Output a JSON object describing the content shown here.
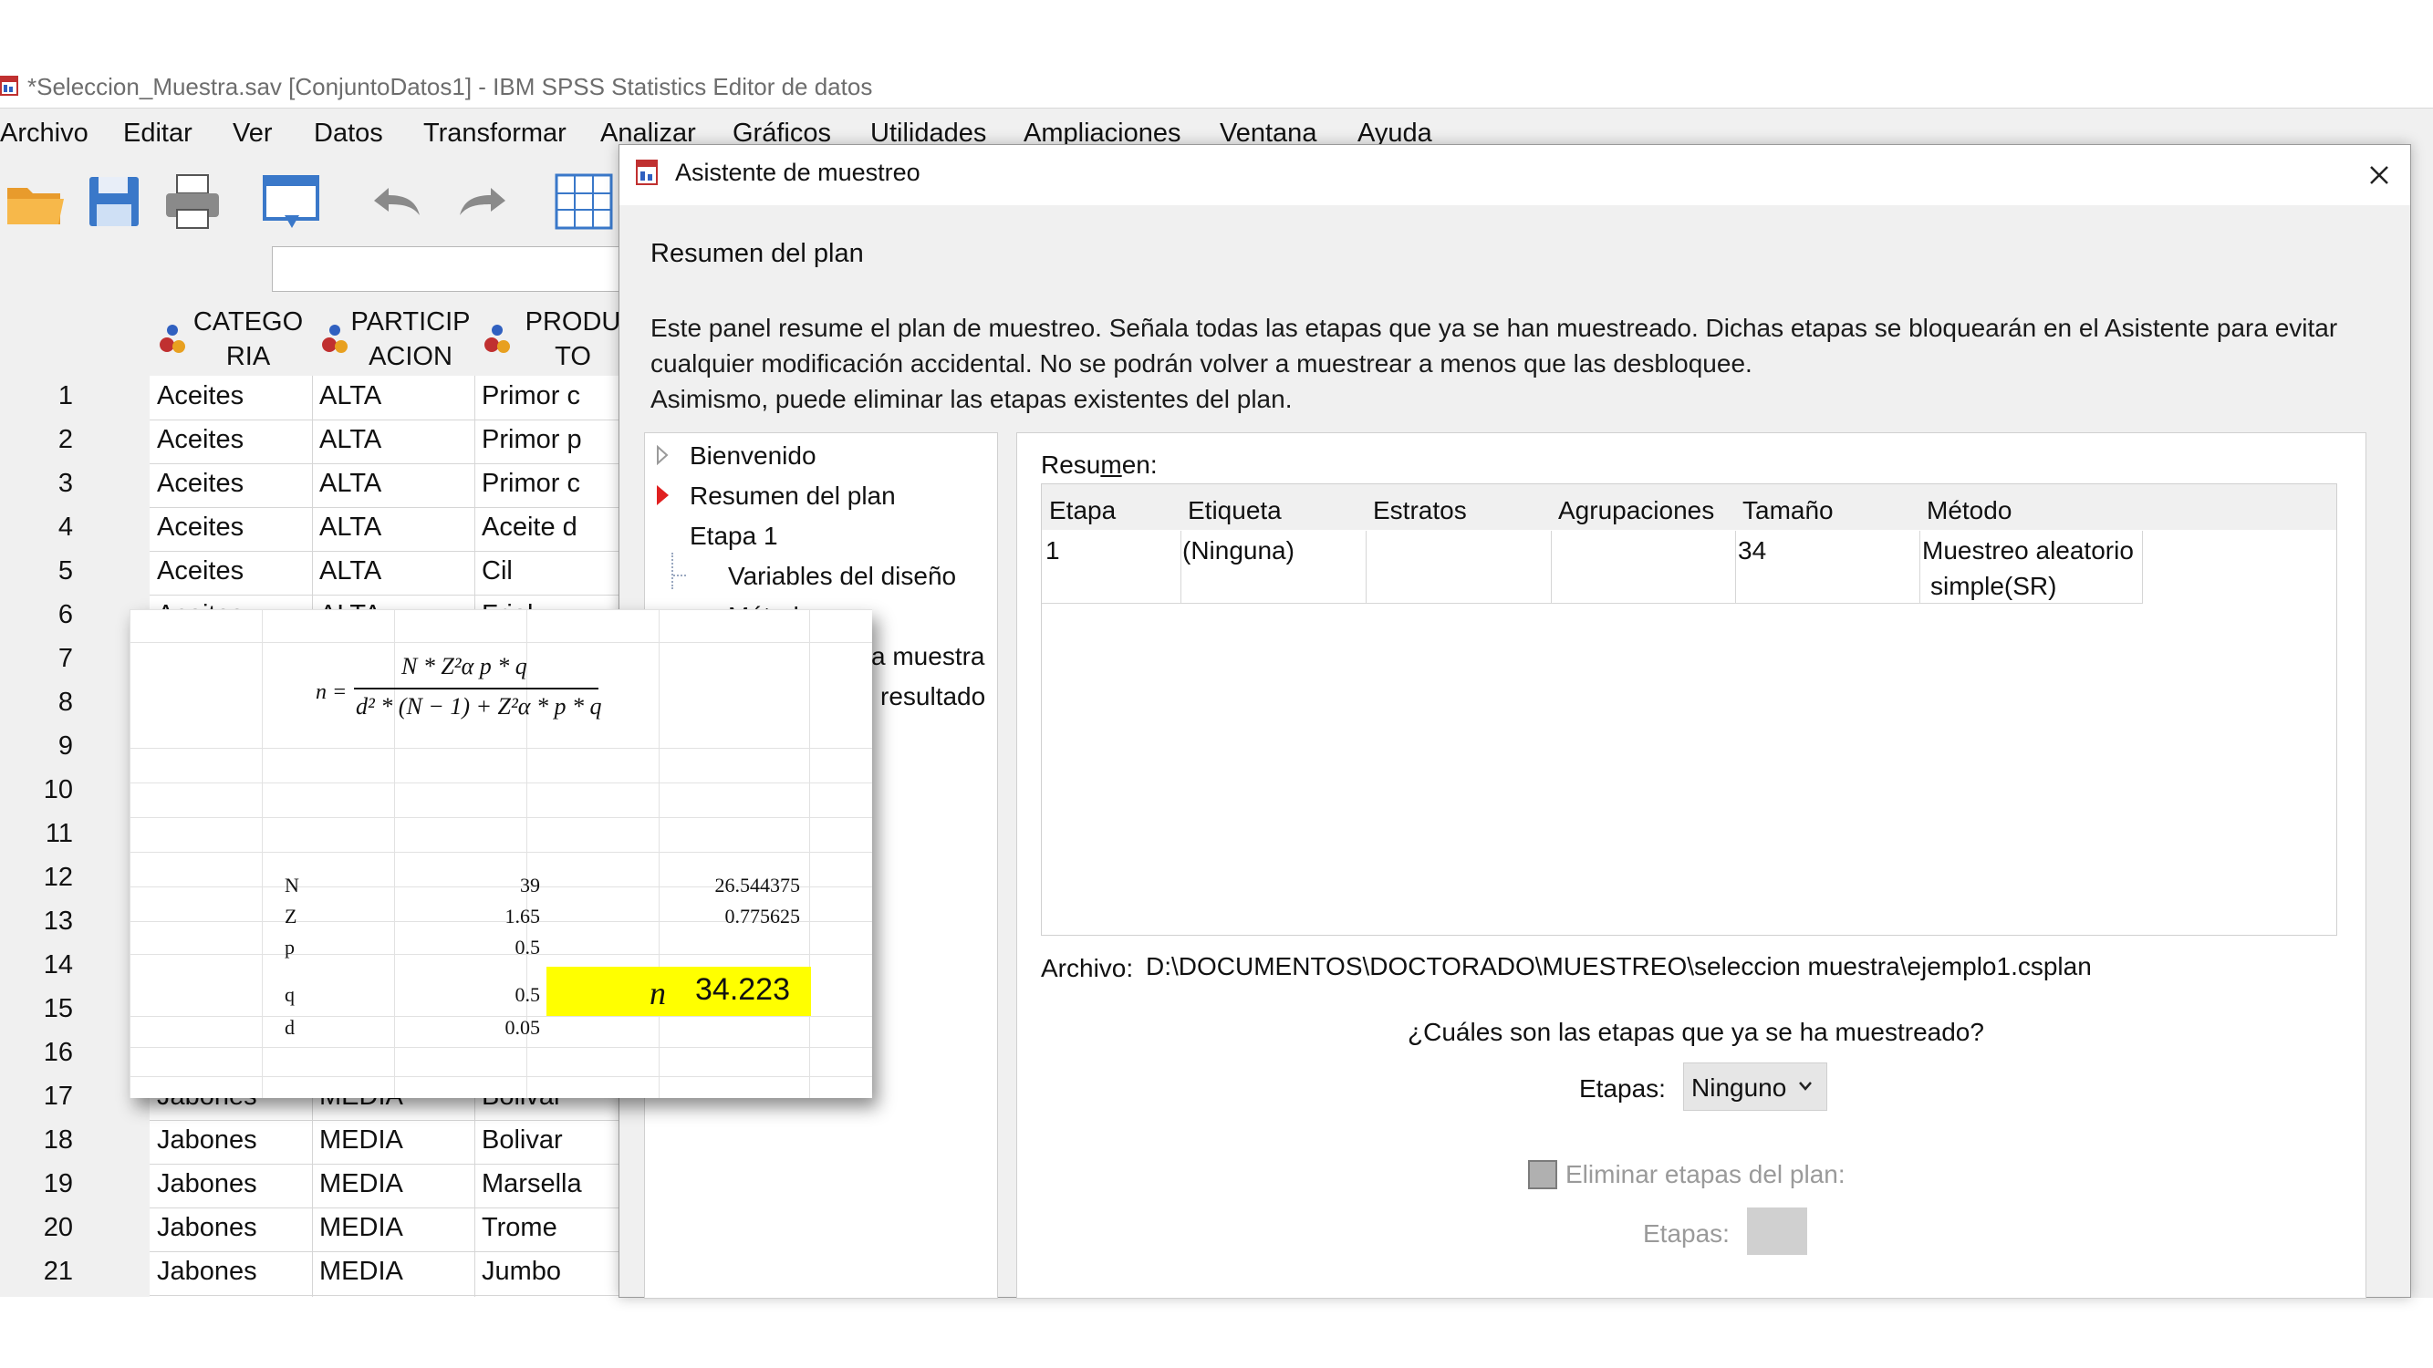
{
  "window": {
    "title": "*Seleccion_Muestra.sav [ConjuntoDatos1] - IBM SPSS Statistics Editor de datos"
  },
  "menu": {
    "archivo": "Archivo",
    "editar": "Editar",
    "ver": "Ver",
    "datos": "Datos",
    "transformar": "Transformar",
    "analizar": "Analizar",
    "graficos": "Gráficos",
    "utilidades": "Utilidades",
    "ampliaciones": "Ampliaciones",
    "ventana": "Ventana",
    "ayuda": "Ayuda"
  },
  "toolbar": {
    "icons": [
      "open-folder-icon",
      "save-icon",
      "print-icon",
      "dialog-recall-icon",
      "undo-icon",
      "redo-icon",
      "goto-case-icon"
    ]
  },
  "grid": {
    "columns": [
      {
        "line1": "CATEGO",
        "line2": "RIA"
      },
      {
        "line1": "PARTICIP",
        "line2": "ACION"
      },
      {
        "line1": "PRODU",
        "line2": "TO"
      }
    ],
    "rows": [
      {
        "n": "1",
        "c1": "Aceites",
        "c2": "ALTA",
        "c3": "Primor c"
      },
      {
        "n": "2",
        "c1": "Aceites",
        "c2": "ALTA",
        "c3": "Primor p"
      },
      {
        "n": "3",
        "c1": "Aceites",
        "c2": "ALTA",
        "c3": "Primor c"
      },
      {
        "n": "4",
        "c1": "Aceites",
        "c2": "ALTA",
        "c3": "Aceite d"
      },
      {
        "n": "5",
        "c1": "Aceites",
        "c2": "ALTA",
        "c3": "Cil"
      },
      {
        "n": "6",
        "c1": "Aceites",
        "c2": "ALTA",
        "c3": "Friol"
      },
      {
        "n": "7",
        "c1": "",
        "c2": "",
        "c3": ""
      },
      {
        "n": "8",
        "c1": "",
        "c2": "",
        "c3": ""
      },
      {
        "n": "9",
        "c1": "",
        "c2": "",
        "c3": ""
      },
      {
        "n": "10",
        "c1": "",
        "c2": "",
        "c3": ""
      },
      {
        "n": "11",
        "c1": "",
        "c2": "",
        "c3": ""
      },
      {
        "n": "12",
        "c1": "",
        "c2": "",
        "c3": ""
      },
      {
        "n": "13",
        "c1": "",
        "c2": "",
        "c3": ""
      },
      {
        "n": "14",
        "c1": "",
        "c2": "",
        "c3": ""
      },
      {
        "n": "15",
        "c1": "",
        "c2": "",
        "c3": ""
      },
      {
        "n": "16",
        "c1": "",
        "c2": "",
        "c3": ""
      },
      {
        "n": "17",
        "c1": "Jabones",
        "c2": "MEDIA",
        "c3": "Bolivar"
      },
      {
        "n": "18",
        "c1": "Jabones",
        "c2": "MEDIA",
        "c3": "Bolivar"
      },
      {
        "n": "19",
        "c1": "Jabones",
        "c2": "MEDIA",
        "c3": "Marsella"
      },
      {
        "n": "20",
        "c1": "Jabones",
        "c2": "MEDIA",
        "c3": "Trome"
      },
      {
        "n": "21",
        "c1": "Jabones",
        "c2": "MEDIA",
        "c3": "Jumbo"
      }
    ]
  },
  "dialog": {
    "title": "Asistente de muestreo",
    "section_title": "Resumen del plan",
    "desc_line1": "Este panel resume el plan de muestreo. Señala todas las etapas que ya se han muestreado. Dichas etapas se bloquearán en el Asistente para evitar",
    "desc_line2": "cualquier modificación accidental. No se podrán volver a muestrear a menos que las desbloquee.",
    "desc_line3": "Asimismo, puede eliminar las etapas existentes del plan.",
    "nav": {
      "bienvenido": "Bienvenido",
      "resumen": "Resumen del plan",
      "etapa1": "Etapa 1",
      "variables": "Variables del diseño",
      "metodo_partial": "Método",
      "muestra_partial": "a muestra",
      "resultado_partial": "resultado"
    },
    "summary_label_pre": "Resu",
    "summary_label_u": "m",
    "summary_label_post": "en:",
    "table": {
      "headers": {
        "etapa": "Etapa",
        "etiqueta": "Etiqueta",
        "estratos": "Estratos",
        "agrupaciones": "Agrupaciones",
        "tamano": "Tamaño",
        "metodo": "Método"
      },
      "row": {
        "etapa": "1",
        "etiqueta": "(Ninguna)",
        "estratos": "",
        "agrupaciones": "",
        "tamano": "34",
        "metodo_l1": "Muestreo aleatorio",
        "metodo_l2": "simple(SR)"
      }
    },
    "archivo_label": "Archivo:",
    "archivo_path": "D:\\DOCUMENTOS\\DOCTORADO\\MUESTREO\\seleccion muestra\\ejemplo1.csplan",
    "question": "¿Cuáles son las etapas que ya se ha muestreado?",
    "etapas_label": "Etapas:",
    "etapas_value": "Ninguno",
    "eliminar_label": "Eliminar etapas del plan:",
    "etapas2_label": "Etapas:"
  },
  "excel": {
    "formula": {
      "lhs": "n =",
      "numerator": "N * Z²α p * q",
      "denominator": "d² * (N − 1) + Z²α * p * q"
    },
    "params": [
      {
        "label": "N",
        "value": "39",
        "extra": "26.544375"
      },
      {
        "label": "Z",
        "value": "1.65",
        "extra": "0.775625"
      },
      {
        "label": "p",
        "value": "0.5",
        "extra": ""
      },
      {
        "label": "q",
        "value": "0.5",
        "extra": ""
      },
      {
        "label": "d",
        "value": "0.05",
        "extra": ""
      }
    ],
    "result_symbol": "n",
    "result_value": "34.223",
    "highlight_color": "#ffff00"
  }
}
